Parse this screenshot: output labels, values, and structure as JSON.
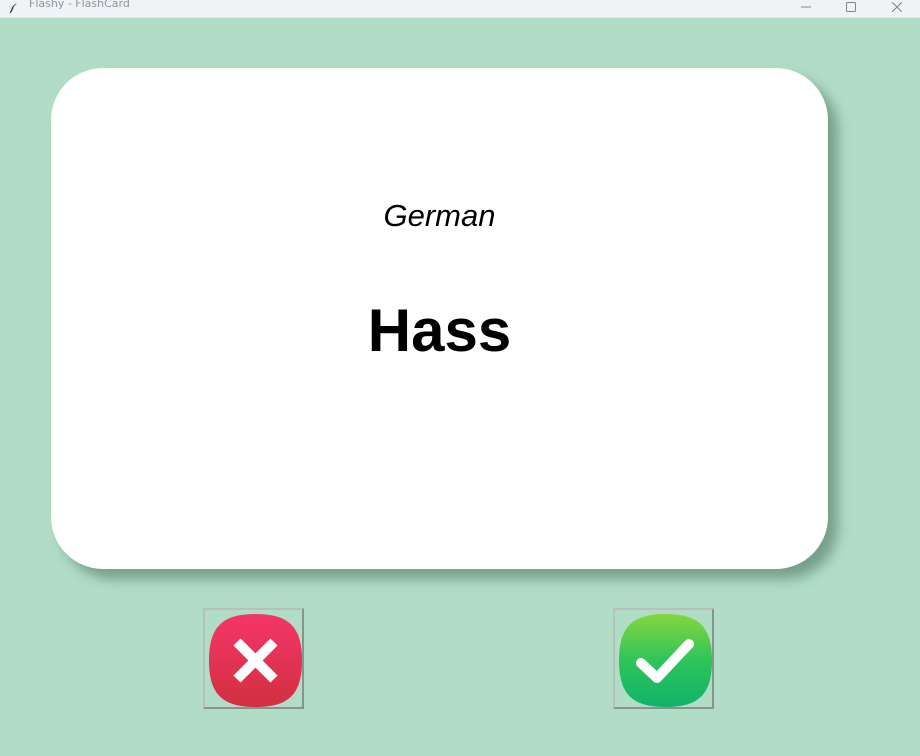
{
  "window": {
    "title": "Flashy - FlashCard",
    "controls": [
      "minimize-icon",
      "maximize-icon",
      "close-icon"
    ]
  },
  "card": {
    "language": "German",
    "word": "Hass"
  },
  "buttons": {
    "wrong": {
      "icon": "x-icon",
      "color": "#e8345a"
    },
    "right": {
      "icon": "checkmark-icon",
      "color": "#2ec45a"
    }
  },
  "colors": {
    "background": "#b1ddc6",
    "card": "#ffffff"
  }
}
